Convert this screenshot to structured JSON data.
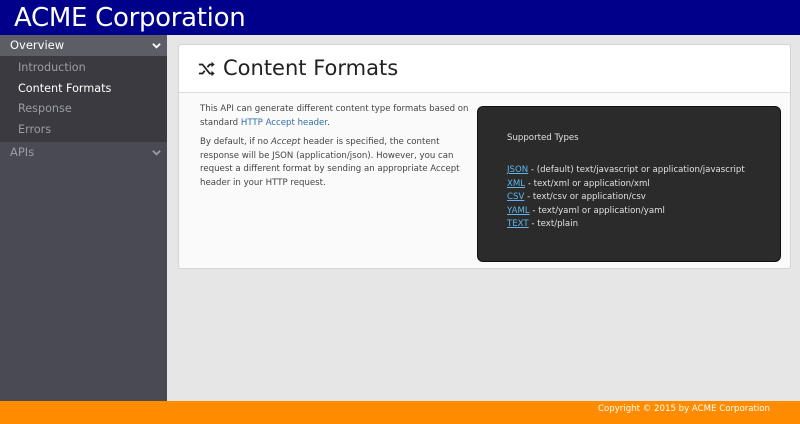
{
  "brand": "ACME Corporation",
  "sidebar": {
    "sections": [
      {
        "label": "Overview",
        "expanded": true,
        "items": [
          {
            "label": "Introduction",
            "active": false
          },
          {
            "label": "Content Formats",
            "active": true
          },
          {
            "label": "Response",
            "active": false
          },
          {
            "label": "Errors",
            "active": false
          }
        ]
      },
      {
        "label": "APIs",
        "expanded": false
      }
    ]
  },
  "page": {
    "title": "Content Formats",
    "icon": "shuffle-icon",
    "para1_before": "This API can generate different content type formats based on standard ",
    "para1_link": "HTTP Accept header",
    "para1_after": ".",
    "para2_before": "By default, if no ",
    "para2_em": "Accept",
    "para2_after": " header is specified, the content response will be JSON (application/json). However, you can request a different format by sending an appropriate Accept header in your HTTP request."
  },
  "types": {
    "title": "Supported Types",
    "items": [
      {
        "format": "JSON",
        "desc": " - (default) text/javascript or application/javascript"
      },
      {
        "format": "XML",
        "desc": " - text/xml or application/xml"
      },
      {
        "format": "CSV",
        "desc": " - text/csv or application/csv"
      },
      {
        "format": "YAML",
        "desc": " - text/yaml or application/yaml"
      },
      {
        "format": "TEXT",
        "desc": " - text/plain"
      }
    ]
  },
  "footer": {
    "copyright": "Copyright © 2015 by ACME Corporation"
  },
  "colors": {
    "topbar": "#00008b",
    "footer": "#ff8c00",
    "link": "#2e6da4",
    "types_link": "#5fb4ec"
  }
}
